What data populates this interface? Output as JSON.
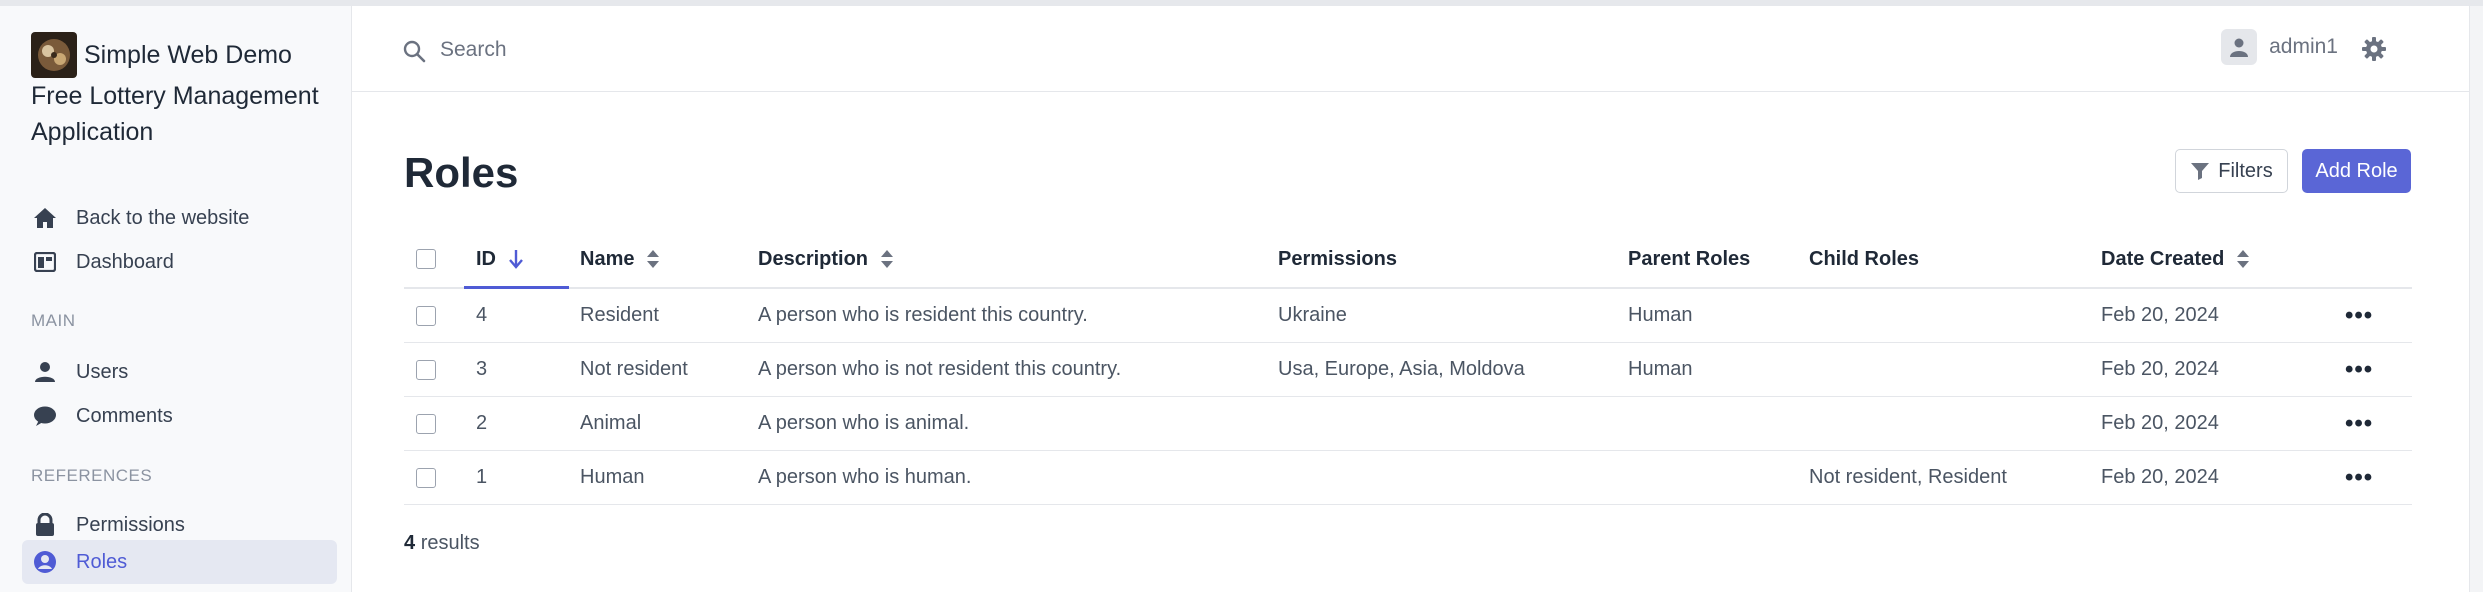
{
  "brand": {
    "title": "Simple Web Demo",
    "subtitle_line1": "Free Lottery Management",
    "subtitle_line2": "Application"
  },
  "sidebar": {
    "top_items": [
      {
        "label": "Back to the website",
        "icon": "home-icon"
      },
      {
        "label": "Dashboard",
        "icon": "dashboard-icon"
      }
    ],
    "sections": [
      {
        "label": "MAIN",
        "items": [
          {
            "label": "Users",
            "icon": "user-icon"
          },
          {
            "label": "Comments",
            "icon": "comment-icon"
          }
        ]
      },
      {
        "label": "REFERENCES",
        "items": [
          {
            "label": "Permissions",
            "icon": "lock-icon"
          },
          {
            "label": "Roles",
            "icon": "user-circle-icon",
            "active": true
          }
        ]
      }
    ]
  },
  "topbar": {
    "search_placeholder": "Search",
    "username": "admin1"
  },
  "page": {
    "title": "Roles",
    "filters_label": "Filters",
    "add_label": "Add Role"
  },
  "table": {
    "columns": [
      "ID",
      "Name",
      "Description",
      "Permissions",
      "Parent Roles",
      "Child Roles",
      "Date Created"
    ],
    "rows": [
      {
        "id": "4",
        "name": "Resident",
        "description": "A person who is resident this country.",
        "permissions": "Ukraine",
        "parent_roles": "Human",
        "child_roles": "",
        "date_created": "Feb 20, 2024"
      },
      {
        "id": "3",
        "name": "Not resident",
        "description": "A person who is not resident this country.",
        "permissions": "Usa, Europe, Asia, Moldova",
        "parent_roles": "Human",
        "child_roles": "",
        "date_created": "Feb 20, 2024"
      },
      {
        "id": "2",
        "name": "Animal",
        "description": "A person who is animal.",
        "permissions": "",
        "parent_roles": "",
        "child_roles": "",
        "date_created": "Feb 20, 2024"
      },
      {
        "id": "1",
        "name": "Human",
        "description": "A person who is human.",
        "permissions": "",
        "parent_roles": "",
        "child_roles": "Not resident, Resident",
        "date_created": "Feb 20, 2024"
      }
    ],
    "row_action": "•••"
  },
  "results": {
    "count": "4",
    "label": "results"
  },
  "colors": {
    "accent": "#5a66d6",
    "sidebar_bg": "#f8f9fb",
    "active_bg": "#e5e8f2"
  }
}
